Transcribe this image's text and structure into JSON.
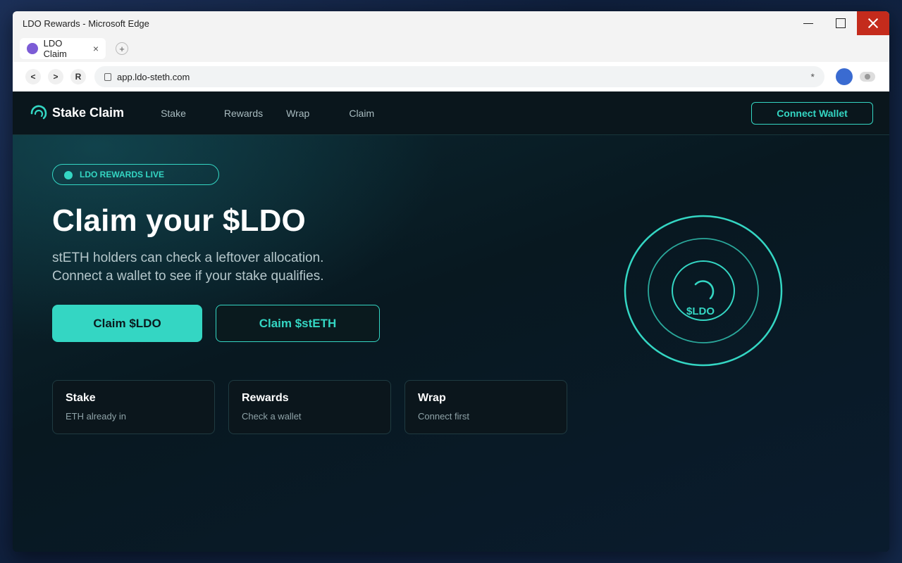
{
  "window": {
    "title": "LDO Rewards - Microsoft Edge"
  },
  "tabs": [
    {
      "label": "LDO Claim"
    }
  ],
  "browser": {
    "back_label": "<",
    "forward_label": ">",
    "reload_label": "R",
    "url": "app.ldo-steth.com",
    "new_tab_label": "+",
    "star_label": "*",
    "tab_close_label": "×"
  },
  "site": {
    "logo_text": "Stake Claim",
    "nav": [
      "Stake",
      "Rewards",
      "Wrap",
      "Claim"
    ],
    "connect_label": "Connect Wallet"
  },
  "hero": {
    "badge": "LDO REWARDS LIVE",
    "title": "Claim your $LDO",
    "subtitle_line1": "stETH holders can check a leftover allocation.",
    "subtitle_line2": "Connect a wallet to see if your stake qualifies.",
    "primary_button": "Claim $LDO",
    "secondary_button": "Claim $stETH",
    "orb_label": "$LDO"
  },
  "cards": [
    {
      "title": "Stake",
      "desc": "ETH already in"
    },
    {
      "title": "Rewards",
      "desc": "Check a wallet"
    },
    {
      "title": "Wrap",
      "desc": "Connect first"
    }
  ],
  "colors": {
    "accent": "#34d6c3",
    "close_button": "#c42b1c",
    "tab_favicon": "#7c5cd6",
    "profile": "#3a6bd1"
  }
}
